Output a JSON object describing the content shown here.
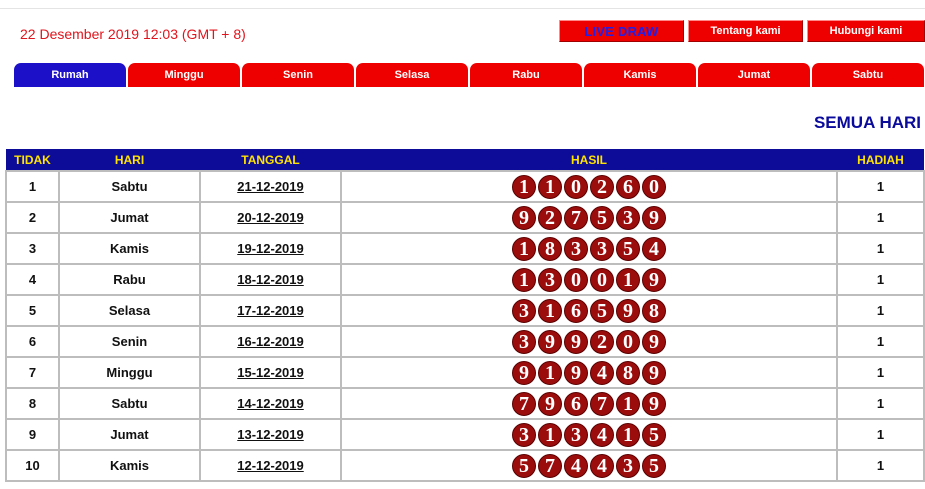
{
  "header": {
    "datetime": "22 Desember 2019 12:03 (GMT + 8)",
    "buttons": [
      {
        "label": "LIVE DRAW",
        "name": "live-draw-button"
      },
      {
        "label": "Tentang kami",
        "name": "tentang-kami-button"
      },
      {
        "label": "Hubungi kami",
        "name": "hubungi-kami-button"
      }
    ]
  },
  "tabs": [
    {
      "label": "Rumah",
      "active": true
    },
    {
      "label": "Minggu",
      "active": false
    },
    {
      "label": "Senin",
      "active": false
    },
    {
      "label": "Selasa",
      "active": false
    },
    {
      "label": "Rabu",
      "active": false
    },
    {
      "label": "Kamis",
      "active": false
    },
    {
      "label": "Jumat",
      "active": false
    },
    {
      "label": "Sabtu",
      "active": false
    }
  ],
  "section_title": "SEMUA HARI",
  "table": {
    "headers": [
      "TIDAK",
      "HARI",
      "TANGGAL",
      "HASIL",
      "HADIAH"
    ],
    "rows": [
      {
        "no": "1",
        "hari": "Sabtu",
        "tanggal": "21-12-2019",
        "hasil": [
          "1",
          "1",
          "0",
          "2",
          "6",
          "0"
        ],
        "hadiah": "1"
      },
      {
        "no": "2",
        "hari": "Jumat",
        "tanggal": "20-12-2019",
        "hasil": [
          "9",
          "2",
          "7",
          "5",
          "3",
          "9"
        ],
        "hadiah": "1"
      },
      {
        "no": "3",
        "hari": "Kamis",
        "tanggal": "19-12-2019",
        "hasil": [
          "1",
          "8",
          "3",
          "3",
          "5",
          "4"
        ],
        "hadiah": "1"
      },
      {
        "no": "4",
        "hari": "Rabu",
        "tanggal": "18-12-2019",
        "hasil": [
          "1",
          "3",
          "0",
          "0",
          "1",
          "9"
        ],
        "hadiah": "1"
      },
      {
        "no": "5",
        "hari": "Selasa",
        "tanggal": "17-12-2019",
        "hasil": [
          "3",
          "1",
          "6",
          "5",
          "9",
          "8"
        ],
        "hadiah": "1"
      },
      {
        "no": "6",
        "hari": "Senin",
        "tanggal": "16-12-2019",
        "hasil": [
          "3",
          "9",
          "9",
          "2",
          "0",
          "9"
        ],
        "hadiah": "1"
      },
      {
        "no": "7",
        "hari": "Minggu",
        "tanggal": "15-12-2019",
        "hasil": [
          "9",
          "1",
          "9",
          "4",
          "8",
          "9"
        ],
        "hadiah": "1"
      },
      {
        "no": "8",
        "hari": "Sabtu",
        "tanggal": "14-12-2019",
        "hasil": [
          "7",
          "9",
          "6",
          "7",
          "1",
          "9"
        ],
        "hadiah": "1"
      },
      {
        "no": "9",
        "hari": "Jumat",
        "tanggal": "13-12-2019",
        "hasil": [
          "3",
          "1",
          "3",
          "4",
          "1",
          "5"
        ],
        "hadiah": "1"
      },
      {
        "no": "10",
        "hari": "Kamis",
        "tanggal": "12-12-2019",
        "hasil": [
          "5",
          "7",
          "4",
          "4",
          "3",
          "5"
        ],
        "hadiah": "1"
      }
    ]
  },
  "colors": {
    "accent_red": "#ee0000",
    "active_tab": "#1c10c8",
    "header_blue": "#0c0c98",
    "header_text": "#ffe300",
    "ball": "#9b0d0d"
  }
}
